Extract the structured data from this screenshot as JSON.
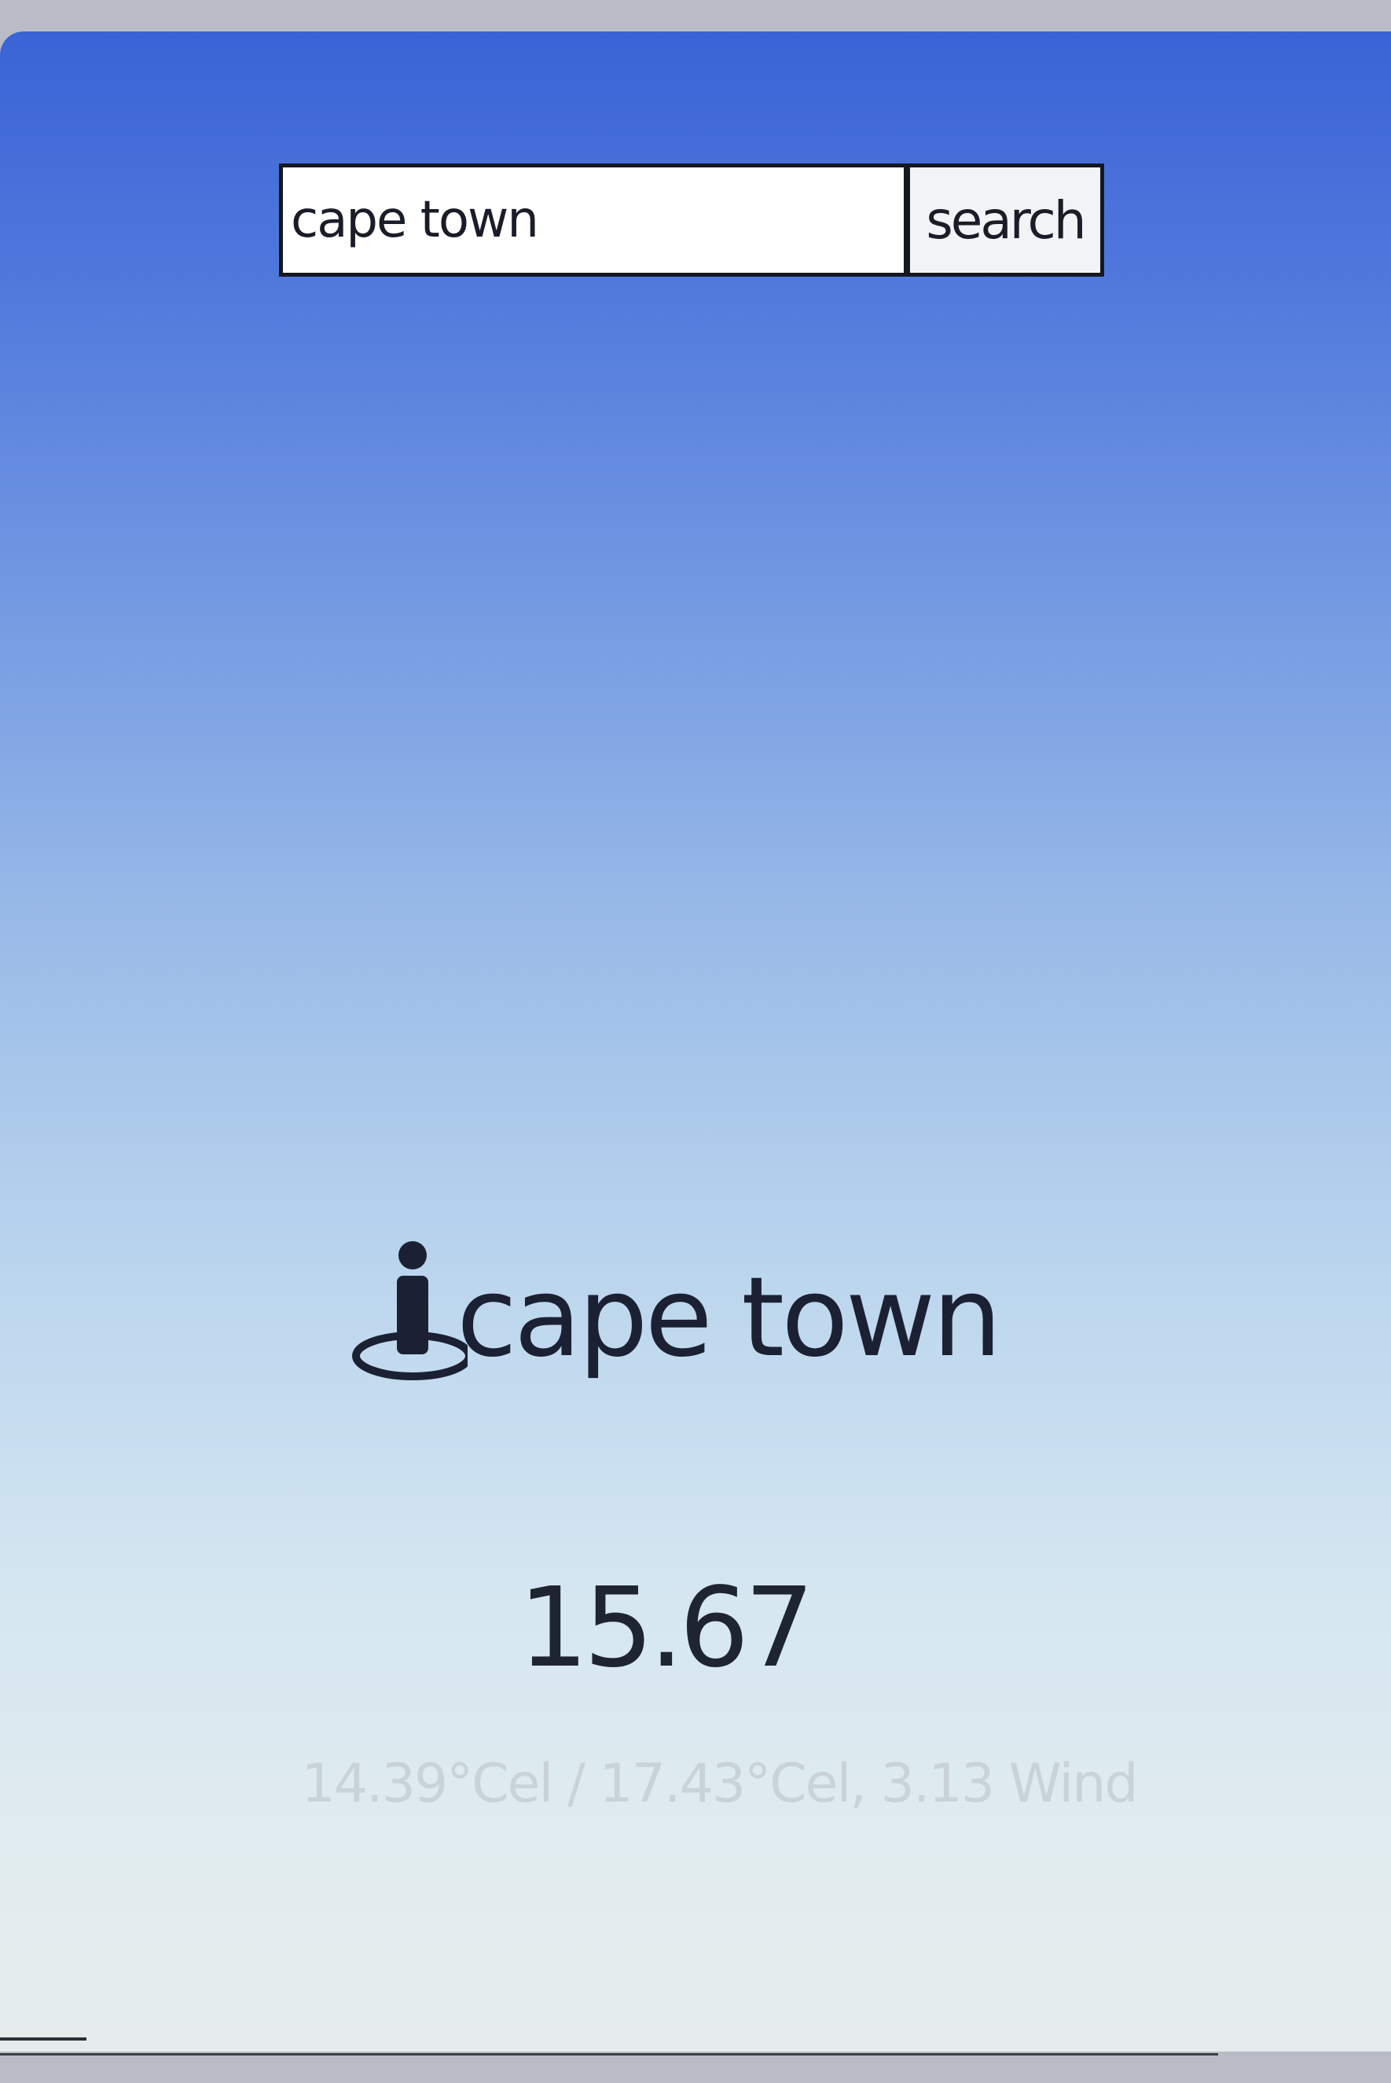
{
  "search": {
    "value": "cape town",
    "button_label": "search"
  },
  "location": {
    "icon": "street-view-icon",
    "name": "cape town"
  },
  "weather": {
    "temperature": "15.67",
    "details": "14.39°Cel / 17.43°Cel, 3.13 Wind"
  }
}
